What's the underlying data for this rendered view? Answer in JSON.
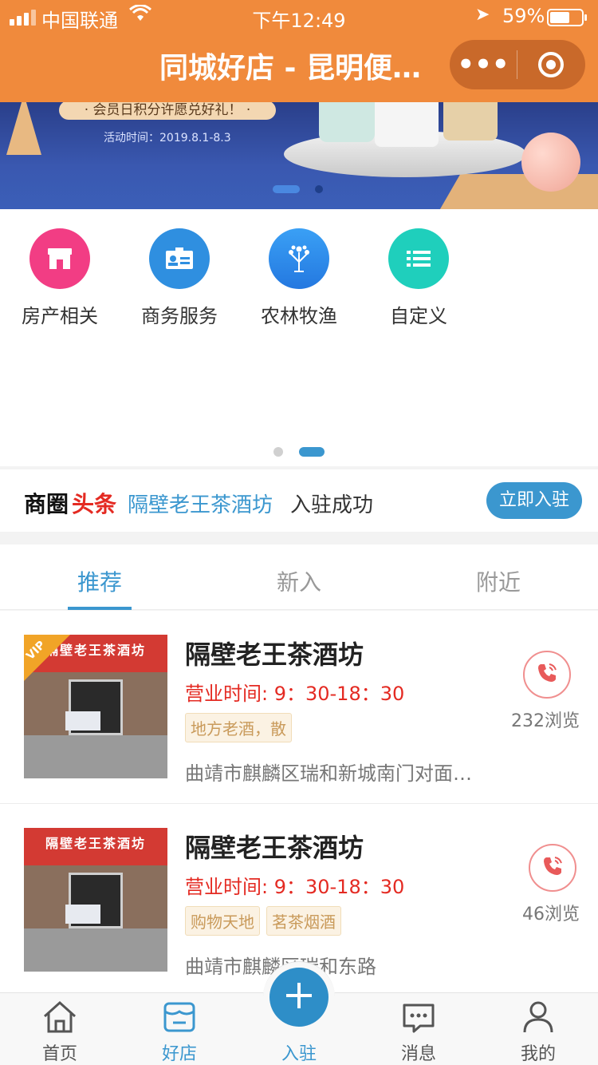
{
  "status_bar": {
    "carrier": "中国联通",
    "time": "下午12:49",
    "battery": "59%"
  },
  "nav": {
    "title": "同城好店 - 昆明便…",
    "more_label": "•••"
  },
  "banner": {
    "promo_text": "· 会员日积分许愿兑好礼！ ·",
    "activity_date": "活动时间：2019.8.1-8.3"
  },
  "categories": [
    {
      "label": "房产相关",
      "icon": "shop-icon",
      "color": "#f23d84"
    },
    {
      "label": "商务服务",
      "icon": "id-card-icon",
      "color": "#2f8fe0"
    },
    {
      "label": "农林牧渔",
      "icon": "tree-icon",
      "color": "#2d8ef0"
    },
    {
      "label": "自定义",
      "icon": "list-icon",
      "color": "#1fcfbc"
    }
  ],
  "headline": {
    "prefix_1": "商圈",
    "prefix_2": "头条",
    "shop_name": "隔壁老王茶酒坊",
    "message": "入驻成功",
    "join_button": "立即入驻"
  },
  "tabs": [
    {
      "label": "推荐",
      "active": true
    },
    {
      "label": "新入",
      "active": false
    },
    {
      "label": "附近",
      "active": false
    }
  ],
  "listings": [
    {
      "name": "隔壁老王茶酒坊",
      "hours": "营业时间: 9：30-18：30",
      "tags": [
        "地方老酒，散"
      ],
      "address": "曲靖市麒麟区瑞和新城南门对面…",
      "views": "232浏览",
      "vip": true,
      "sign_text": "隔壁老王茶酒坊",
      "vip_label": "VIP"
    },
    {
      "name": "隔壁老王茶酒坊",
      "hours": "营业时间: 9：30-18：30",
      "tags": [
        "购物天地",
        "茗茶烟酒"
      ],
      "address": "曲靖市麒麟区瑞和东路",
      "views": "46浏览",
      "vip": false,
      "sign_text": "隔壁老王茶酒坊"
    }
  ],
  "tabbar": {
    "home": "首页",
    "shops": "好店",
    "join": "入驻",
    "messages": "消息",
    "mine": "我的"
  },
  "colors": {
    "nav_bg": "#f08a3c",
    "accent_blue": "#3b97cf",
    "red": "#e42a22"
  }
}
